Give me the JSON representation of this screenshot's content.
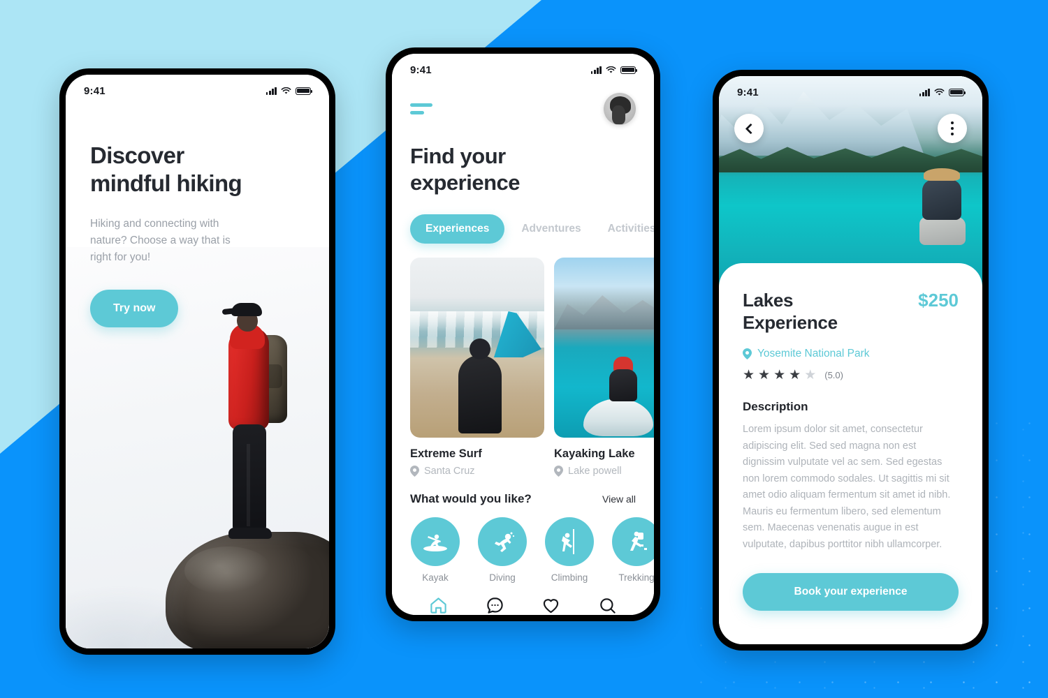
{
  "theme": {
    "accent": "#5DC9D6",
    "background_blue": "#0A93FB",
    "background_lightblue": "#ACE5F5",
    "dark_text": "#262A31",
    "muted_text": "#AEB3B9"
  },
  "status_bar": {
    "time": "9:41",
    "signal_icon": "cellular-signal-icon",
    "wifi_icon": "wifi-icon",
    "battery_icon": "battery-icon"
  },
  "screen_onboarding": {
    "title_line1": "Discover",
    "title_line2": "mindful hiking",
    "subtitle": "Hiking and connecting with nature? Choose a way that is right for you!",
    "cta_label": "Try now",
    "hero_image_alt": "hiker-on-rock-photo"
  },
  "screen_home": {
    "menu_icon": "hamburger-menu-icon",
    "avatar_alt": "user-avatar",
    "title_line1": "Find your",
    "title_line2": "experience",
    "tabs": [
      {
        "label": "Experiences",
        "active": true
      },
      {
        "label": "Adventures",
        "active": false
      },
      {
        "label": "Activities",
        "active": false
      }
    ],
    "cards": [
      {
        "title": "Extreme Surf",
        "location": "Santa Cruz",
        "image_alt": "surfer-on-beach-photo"
      },
      {
        "title": "Kayaking Lake",
        "location": "Lake powell",
        "image_alt": "kayaker-on-lake-photo"
      }
    ],
    "section_title": "What would you like?",
    "view_all_label": "View all",
    "categories": [
      {
        "label": "Kayak",
        "icon": "kayak-icon"
      },
      {
        "label": "Diving",
        "icon": "diving-icon"
      },
      {
        "label": "Climbing",
        "icon": "climbing-icon"
      },
      {
        "label": "Trekking",
        "icon": "trekking-icon"
      }
    ],
    "nav": [
      {
        "icon": "home-icon",
        "active": true
      },
      {
        "icon": "chat-icon",
        "active": false
      },
      {
        "icon": "heart-icon",
        "active": false
      },
      {
        "icon": "search-icon",
        "active": false
      }
    ]
  },
  "screen_detail": {
    "back_icon": "chevron-left-icon",
    "menu_icon": "more-vertical-icon",
    "hero_image_alt": "turquoise-mountain-lake-photo",
    "title_line1": "Lakes",
    "title_line2": "Experience",
    "price": "$250",
    "location": "Yosemite National Park",
    "location_icon": "map-pin-icon",
    "stars_filled": 4,
    "stars_total": 5,
    "rating_label": "(5.0)",
    "description_heading": "Description",
    "description": "Lorem ipsum dolor sit amet, consectetur adipiscing elit. Sed sed magna non est dignissim vulputate vel ac sem. Sed egestas non lorem commodo sodales. Ut sagittis mi sit amet odio aliquam fermentum sit amet id nibh. Mauris eu fermentum libero, sed elementum sem. Maecenas venenatis augue in est vulputate, dapibus porttitor nibh ullamcorper.",
    "book_label": "Book your experience"
  }
}
